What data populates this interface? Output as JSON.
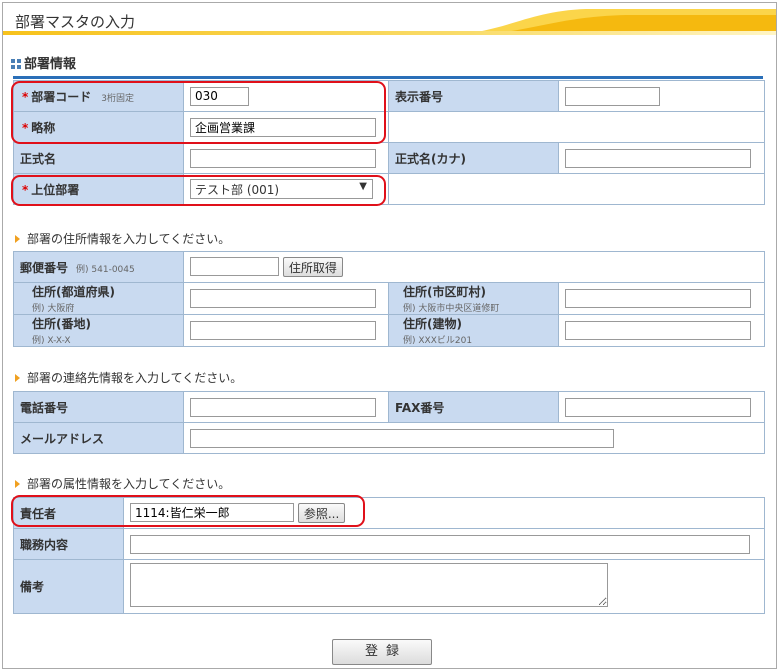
{
  "page_title": "部署マスタの入力",
  "section_title": "部署情報",
  "section1": {
    "dept_code_label": "部署コード",
    "dept_code_note": "3桁固定",
    "dept_code_value": "030",
    "display_no_label": "表示番号",
    "display_no_value": "",
    "abbrev_label": "略称",
    "abbrev_value": "企画営業課",
    "official_name_label": "正式名",
    "official_name_value": "",
    "official_kana_label": "正式名(カナ)",
    "official_kana_value": "",
    "parent_label": "上位部署",
    "parent_value": "テスト部 (001)",
    "required_mark": "*"
  },
  "address_info": "部署の住所情報を入力してください。",
  "section2": {
    "zip_label": "郵便番号",
    "zip_example": "例) 541-0045",
    "zip_value": "",
    "zip_button": "住所取得",
    "pref_label": "住所(都道府県)",
    "pref_example": "例) 大阪府",
    "pref_value": "",
    "city_label": "住所(市区町村)",
    "city_example": "例) 大阪市中央区道修町",
    "city_value": "",
    "block_label": "住所(番地)",
    "block_example": "例) X-X-X",
    "block_value": "",
    "building_label": "住所(建物)",
    "building_example": "例) XXXビル201",
    "building_value": ""
  },
  "contact_info": "部署の連絡先情報を入力してください。",
  "section3": {
    "phone_label": "電話番号",
    "phone_value": "",
    "fax_label": "FAX番号",
    "fax_value": "",
    "email_label": "メールアドレス",
    "email_value": ""
  },
  "attr_info": "部署の属性情報を入力してください。",
  "section4": {
    "manager_label": "責任者",
    "manager_value": "1114:皆仁栄一郎",
    "manager_button": "参照...",
    "duties_label": "職務内容",
    "duties_value": "",
    "notes_label": "備考",
    "notes_value": ""
  },
  "submit_label": "登録",
  "colors": {
    "label_bg": "#c9daf0",
    "accent_blue": "#2a6fb8",
    "required_red": "#dd0000",
    "highlight_red": "#e0101a",
    "header_gold": "#f7c21b"
  }
}
